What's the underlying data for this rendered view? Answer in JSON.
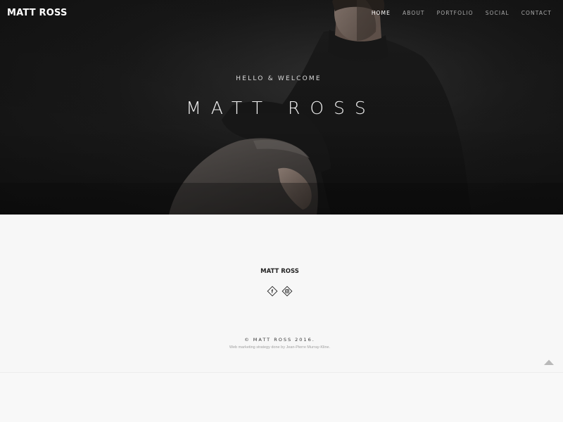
{
  "header": {
    "logo": "MATT ROSS",
    "nav": [
      {
        "label": "HOME",
        "active": true
      },
      {
        "label": "ABOUT",
        "active": false
      },
      {
        "label": "PORTFOLIO",
        "active": false
      },
      {
        "label": "SOCIAL",
        "active": false
      },
      {
        "label": "CONTACT",
        "active": false
      }
    ]
  },
  "hero": {
    "subtitle": "HELLO & WELCOME",
    "title": "MATT ROSS"
  },
  "footer": {
    "name": "MATT ROSS",
    "social": [
      {
        "icon": "facebook-icon",
        "label": "f"
      },
      {
        "icon": "instagram-icon"
      }
    ],
    "copyright": "© MATT ROSS 2016.",
    "credit": "Web marketing strategy done by Jean-Pierre Murray-Kline."
  },
  "colors": {
    "hero_background": "#161616",
    "footer_background": "#f7f7f7",
    "nav_inactive": "#a8a8a8",
    "nav_active": "#ffffff"
  }
}
